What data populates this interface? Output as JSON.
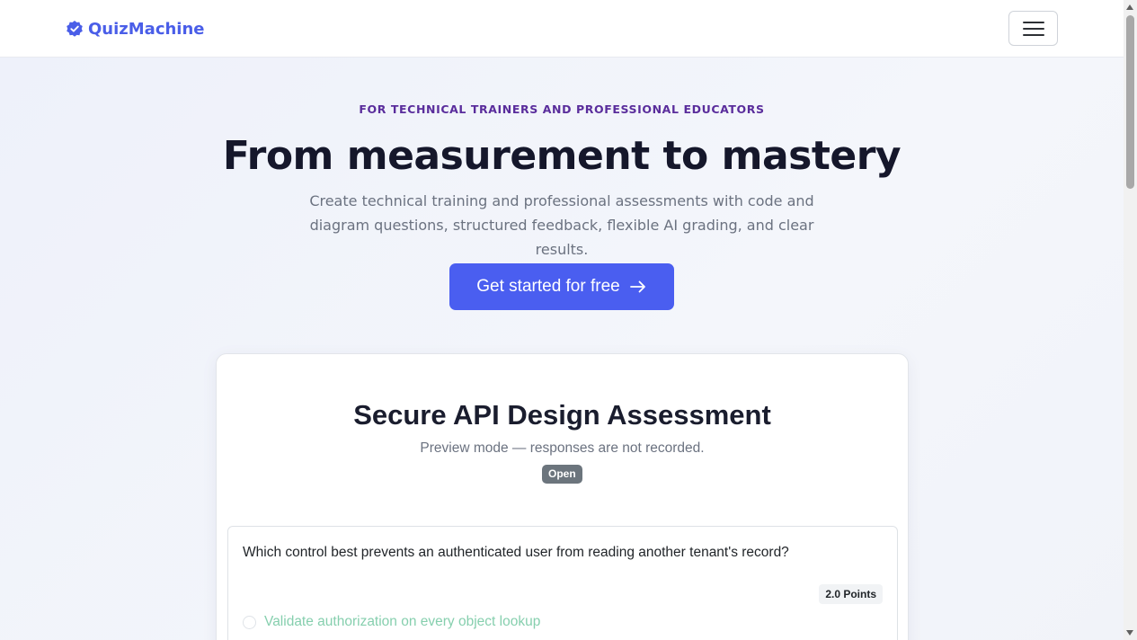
{
  "navbar": {
    "brand": "QuizMachine",
    "brand_icon": "verified-badge-icon",
    "menu_icon": "hamburger-menu-icon",
    "accent_color": "#4a5ee8"
  },
  "hero": {
    "kicker": "FOR TECHNICAL TRAINERS AND PROFESSIONAL EDUCATORS",
    "headline": "From measurement to mastery",
    "subtext": "Create technical training and professional assessments with code and diagram questions, structured feedback, flexible AI grading, and clear results.",
    "cta_label": "Get started for free",
    "cta_icon": "arrow-right-icon",
    "cta_color": "#4a5ef0"
  },
  "preview": {
    "title": "Secure API Design Assessment",
    "subtitle": "Preview mode — responses are not recorded.",
    "status_badge": "Open",
    "question": {
      "text": "Which control best prevents an authenticated user from reading another tenant's record?",
      "points": "2.0 Points",
      "options": [
        {
          "label": "Validate authorization on every object lookup"
        }
      ]
    }
  }
}
